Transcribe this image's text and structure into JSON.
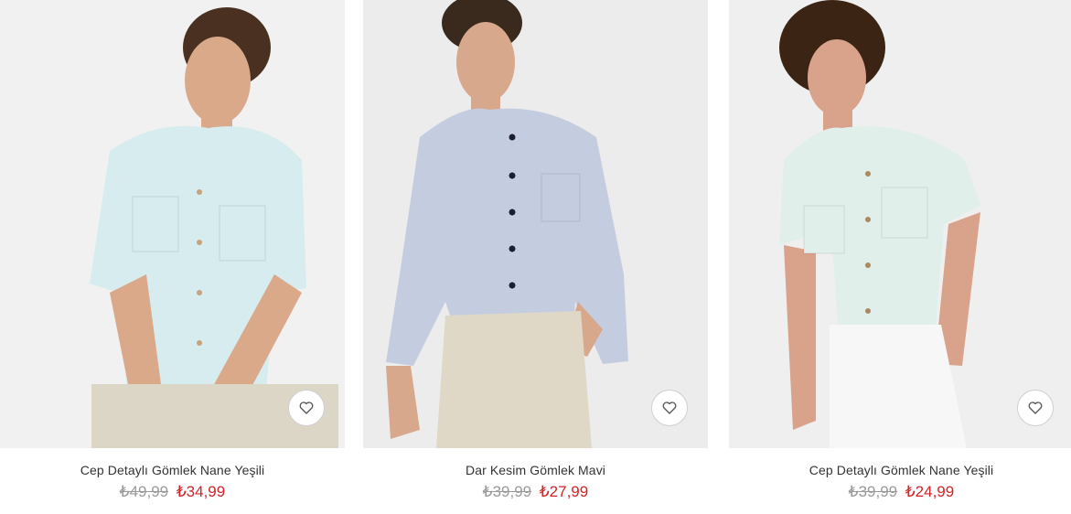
{
  "products": [
    {
      "title": "Cep Detaylı Gömlek Nane Yeşili",
      "old_price": "₺49,99",
      "price": "₺34,99",
      "colors": {
        "bg": "#f1f1f1",
        "shirt": "#d6ecef",
        "pants": "#dcd6c6",
        "skin": "#d9a98a",
        "hair": "#4a3020",
        "button": "#c8a27c"
      }
    },
    {
      "title": "Dar Kesim Gömlek Mavi",
      "old_price": "₺39,99",
      "price": "₺27,99",
      "colors": {
        "bg": "#ececec",
        "shirt": "#c4cde0",
        "pants": "#e0d8c6",
        "skin": "#d8a88c",
        "hair": "#3a2a1e",
        "button": "#1c1e2e"
      }
    },
    {
      "title": "Cep Detaylı Gömlek Nane Yeşili",
      "old_price": "₺39,99",
      "price": "₺24,99",
      "colors": {
        "bg": "#efefef",
        "shirt": "#e0efea",
        "pants": "#f7f7f7",
        "skin": "#d9a28a",
        "hair": "#3b2414",
        "button": "#a88964"
      }
    }
  ],
  "favorite_icon": "heart-outline-icon",
  "accent_price_color": "#d0232a",
  "old_price_color": "#9a9a9a"
}
